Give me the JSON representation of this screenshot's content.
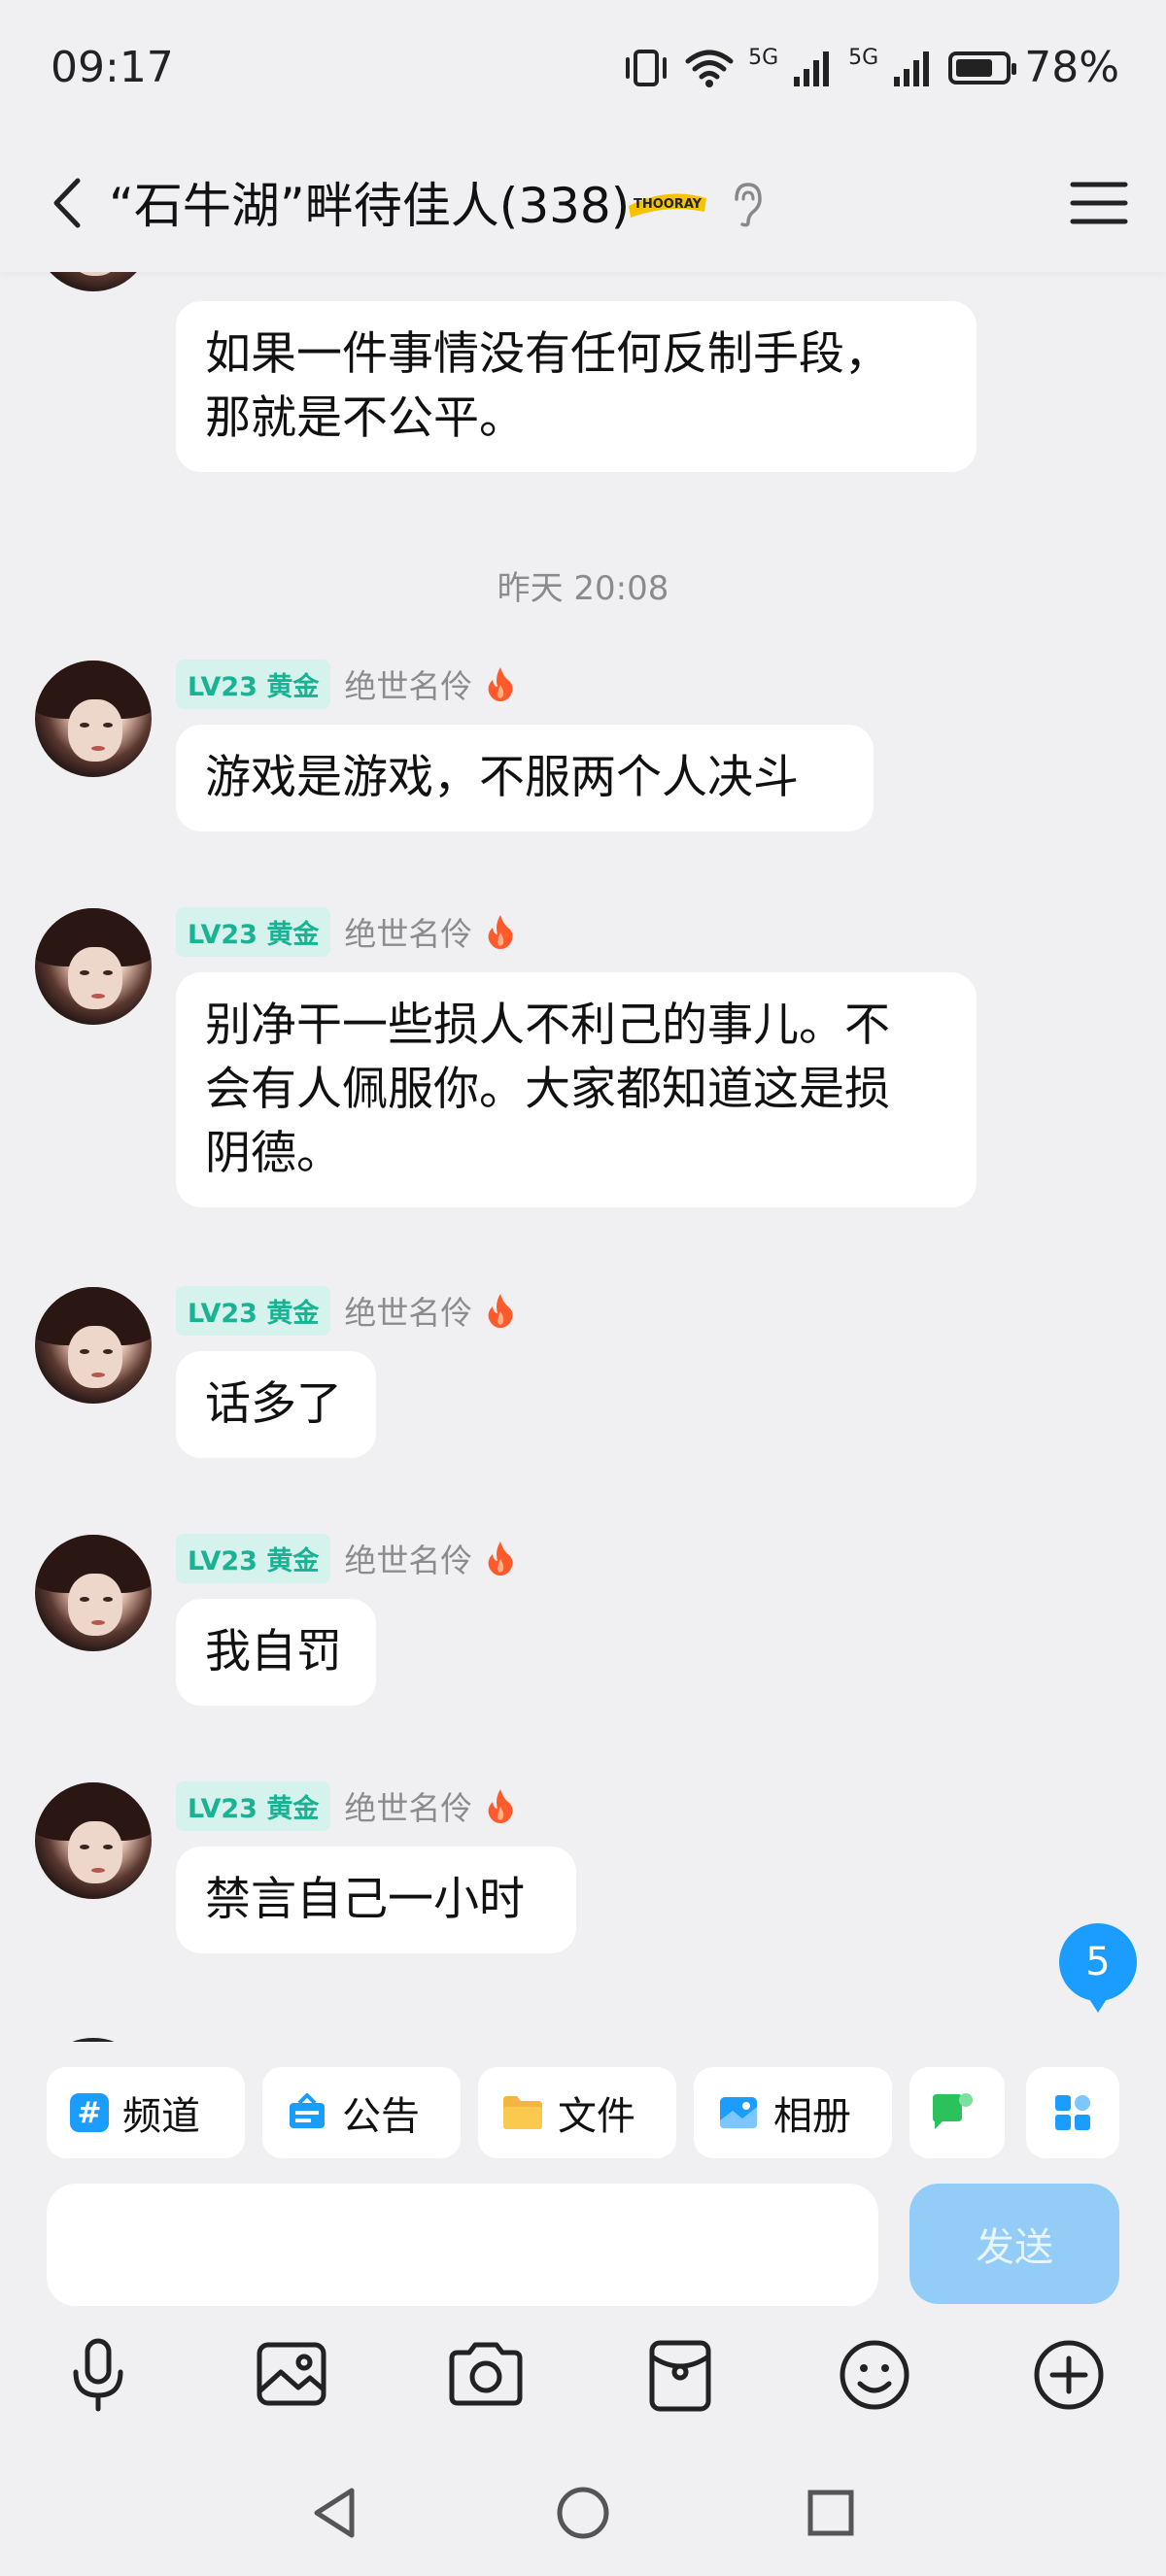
{
  "status_bar": {
    "time": "09:17",
    "network_1": "5G",
    "network_2": "5G",
    "battery_percent_label": "78%",
    "battery_level": 0.78
  },
  "header": {
    "title": "“石牛湖”畔待佳人(338)",
    "badge_text": "THOORAY"
  },
  "chat": {
    "partial_top_message": {
      "text": "如果一件事情没有任何反制手段，\n那就是不公平。"
    },
    "time_separator": "昨天 20:08",
    "messages": [
      {
        "level": "LV23 黄金",
        "nickname": "绝世名伶",
        "text": "游戏是游戏，不服两个人决斗"
      },
      {
        "level": "LV23 黄金",
        "nickname": "绝世名伶",
        "text": "别净干一些损人不利己的事儿。不\n会有人佩服你。大家都知道这是损\n阴德。"
      },
      {
        "level": "LV23 黄金",
        "nickname": "绝世名伶",
        "text": "话多了"
      },
      {
        "level": "LV23 黄金",
        "nickname": "绝世名伶",
        "text": "我自罚"
      },
      {
        "level": "LV23 黄金",
        "nickname": "绝世名伶",
        "text": "禁言自己一小时"
      }
    ],
    "unread_count": "5"
  },
  "quick_bar": {
    "items": [
      {
        "label": "频道",
        "icon": "hash-icon",
        "color": "#1a9dff"
      },
      {
        "label": "公告",
        "icon": "announcement-icon",
        "color": "#1a9dff"
      },
      {
        "label": "文件",
        "icon": "folder-icon",
        "color": "#f5b53b"
      },
      {
        "label": "相册",
        "icon": "album-icon",
        "color": "#1a9dff"
      }
    ]
  },
  "input": {
    "placeholder": "",
    "send_label": "发送"
  },
  "colors": {
    "accent": "#1a9dff",
    "level_badge_bg": "#d6f2ec",
    "level_badge_text": "#19b394",
    "send_disabled": "#93cdf7"
  }
}
